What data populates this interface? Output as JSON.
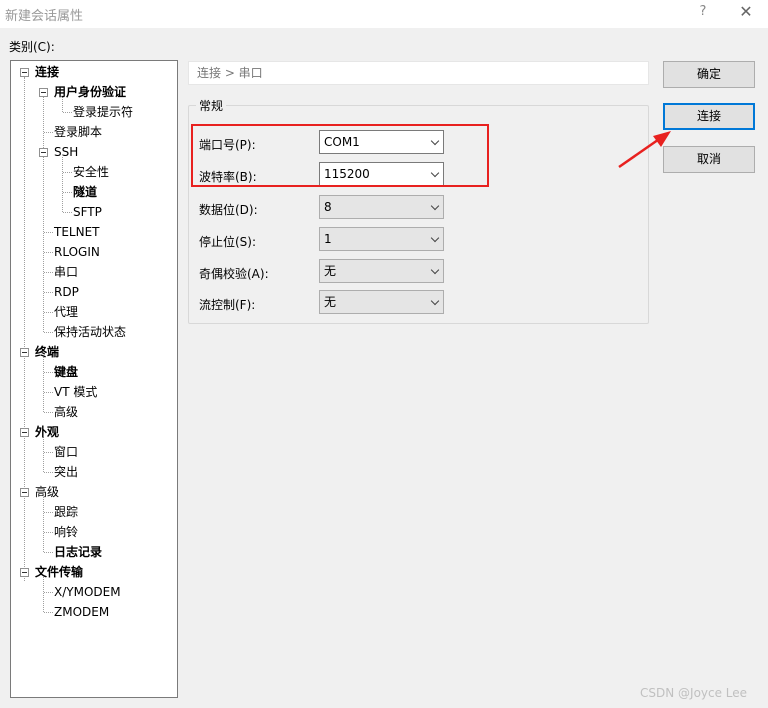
{
  "window": {
    "title": "新建会话属性",
    "help_glyph": "?",
    "close_glyph": "✕"
  },
  "category_label": "类别(C):",
  "tree": {
    "connection": "连接",
    "user_auth": "用户身份验证",
    "login_prompts": "登录提示符",
    "login_script": "登录脚本",
    "ssh": "SSH",
    "security": "安全性",
    "tunnel": "隧道",
    "sftp": "SFTP",
    "telnet": "TELNET",
    "rlogin": "RLOGIN",
    "serial": "串口",
    "rdp": "RDP",
    "proxy": "代理",
    "keepalive": "保持活动状态",
    "terminal": "终端",
    "keyboard": "键盘",
    "vt_mode": "VT 模式",
    "term_advanced": "高级",
    "appearance": "外观",
    "window": "窗口",
    "highlight": "突出",
    "advanced": "高级",
    "trace": "跟踪",
    "bell": "响铃",
    "logging": "日志记录",
    "file_transfer": "文件传输",
    "xymodem": "X/YMODEM",
    "zmodem": "ZMODEM"
  },
  "breadcrumb": "连接 > 串口",
  "group_title": "常规",
  "fields": {
    "port": {
      "label": "端口号(P):",
      "value": "COM1"
    },
    "baud": {
      "label": "波特率(B):",
      "value": "115200"
    },
    "data_bits": {
      "label": "数据位(D):",
      "value": "8"
    },
    "stop_bits": {
      "label": "停止位(S):",
      "value": "1"
    },
    "parity": {
      "label": "奇偶校验(A):",
      "value": "无"
    },
    "flow": {
      "label": "流控制(F):",
      "value": "无"
    }
  },
  "buttons": {
    "ok": "确定",
    "connect": "连接",
    "cancel": "取消"
  },
  "watermark": "CSDN @Joyce   Lee",
  "colors": {
    "annotation": "#e8211f",
    "focus": "#0078d7"
  }
}
